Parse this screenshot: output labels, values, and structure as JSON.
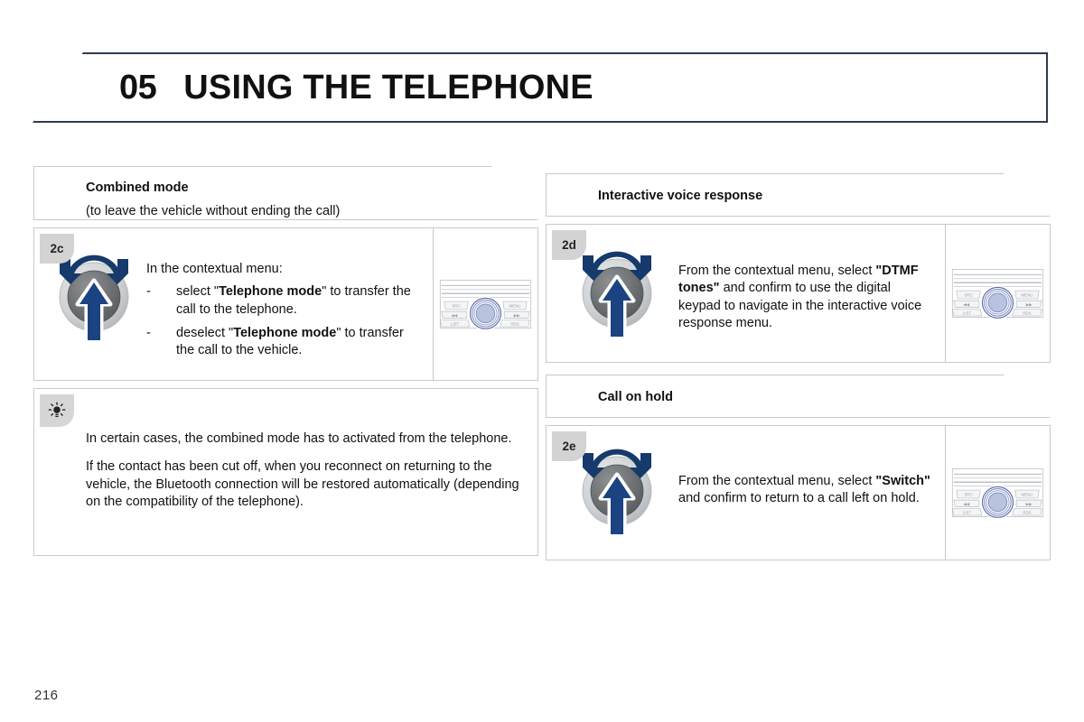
{
  "header": {
    "chapter_number": "05",
    "chapter_title": "USING THE TELEPHONE",
    "border_color": "#2d3b50"
  },
  "left_column": {
    "section": {
      "title": "Combined mode",
      "subtitle": "(to leave the vehicle without ending the call)"
    },
    "step": {
      "badge": "2c",
      "lead": "In the contextual menu:",
      "bullets": [
        {
          "dash": "-",
          "pre": "select \"",
          "strong": "Telephone mode",
          "post": "\" to transfer the call to the telephone."
        },
        {
          "dash": "-",
          "pre": "deselect \"",
          "strong": "Telephone mode",
          "post": "\" to transfer the call to the vehicle."
        }
      ],
      "thumbnail": "car-audio-rotary-knob"
    },
    "tip": {
      "badge_icon": "light-bulb-icon",
      "paragraph_1": "In certain cases, the combined mode has to activated from the telephone.",
      "paragraph_2": "If the contact has been cut off, when you reconnect on returning to the vehicle, the Bluetooth connection will be restored automatically (depending on the compatibility of the telephone)."
    }
  },
  "right_column": {
    "section_1": {
      "title": "Interactive voice response"
    },
    "step_2d": {
      "badge": "2d",
      "pre": "From the contextual menu, select ",
      "strong": "\"DTMF tones\"",
      "post": " and confirm to use the digital keypad to navigate in the interactive voice response menu.",
      "thumbnail": "car-audio-rotary-knob"
    },
    "section_2": {
      "title": "Call on hold"
    },
    "step_2e": {
      "badge": "2e",
      "pre": "From the contextual menu, select ",
      "strong": "\"Switch\"",
      "post": " and confirm to return to a call left on hold.",
      "thumbnail": "car-audio-rotary-knob"
    }
  },
  "radio_panel": {
    "buttons": [
      "SRC",
      "MENU",
      "◀◀",
      "▶▶",
      "LIST",
      "RDS"
    ],
    "knob_color": "#9aa8cf"
  },
  "footer": {
    "page_number": "216"
  },
  "colors": {
    "panel_border": "#c9c9c9",
    "badge_bg": "#d3d3d3",
    "arrow_navy": "#153a6b",
    "knob_outer": "#c4c7c9",
    "knob_inner": "#6c7071"
  }
}
